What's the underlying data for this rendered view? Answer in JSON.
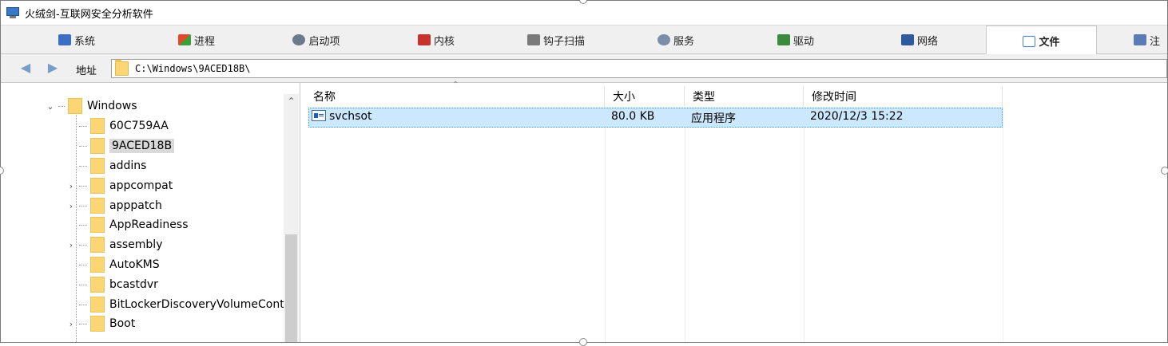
{
  "window": {
    "title": "火绒剑-互联网安全分析软件"
  },
  "tabs": [
    {
      "label": "系统",
      "icon": "system-icon",
      "color": "#3a6fc4"
    },
    {
      "label": "进程",
      "icon": "process-icon",
      "color": "#e24a2a"
    },
    {
      "label": "启动项",
      "icon": "startup-icon",
      "color": "#6c7a8a"
    },
    {
      "label": "内核",
      "icon": "kernel-icon",
      "color": "#c8322a"
    },
    {
      "label": "钩子扫描",
      "icon": "hook-icon",
      "color": "#7a7a7a"
    },
    {
      "label": "服务",
      "icon": "service-icon",
      "color": "#7b8da8"
    },
    {
      "label": "驱动",
      "icon": "driver-icon",
      "color": "#3c8a3c"
    },
    {
      "label": "网络",
      "icon": "network-icon",
      "color": "#2c5a9a"
    },
    {
      "label": "文件",
      "icon": "file-icon",
      "color": "#4a86c8",
      "active": true
    },
    {
      "label": "注",
      "icon": "registry-icon",
      "color": "#5a7ab8"
    }
  ],
  "address": {
    "label": "地址",
    "value": "C:\\Windows\\9ACED18B\\"
  },
  "tree": {
    "root": "Windows",
    "items": [
      {
        "label": "60C759AA",
        "expandable": false
      },
      {
        "label": "9ACED18B",
        "expandable": false,
        "selected": true
      },
      {
        "label": "addins",
        "expandable": false
      },
      {
        "label": "appcompat",
        "expandable": true
      },
      {
        "label": "apppatch",
        "expandable": true
      },
      {
        "label": "AppReadiness",
        "expandable": false
      },
      {
        "label": "assembly",
        "expandable": true
      },
      {
        "label": "AutoKMS",
        "expandable": false
      },
      {
        "label": "bcastdvr",
        "expandable": false
      },
      {
        "label": "BitLockerDiscoveryVolumeConte",
        "expandable": false
      },
      {
        "label": "Boot",
        "expandable": true
      }
    ]
  },
  "file_list": {
    "columns": [
      "名称",
      "大小",
      "类型",
      "修改时间"
    ],
    "rows": [
      {
        "name": "svchsot",
        "size": "80.0 KB",
        "type": "应用程序",
        "modified": "2020/12/3 15:22"
      }
    ]
  }
}
